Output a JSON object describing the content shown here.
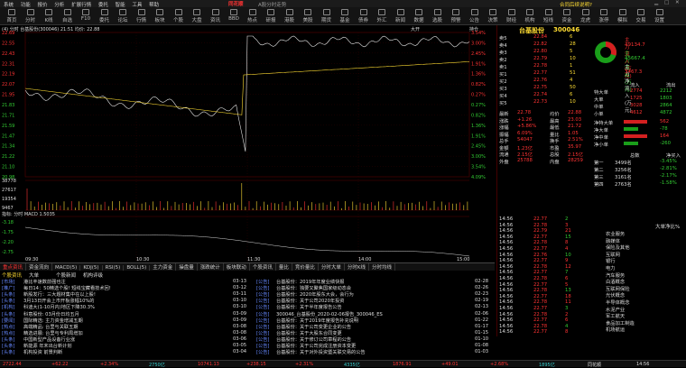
{
  "titlebar": {
    "menus": [
      "系统",
      "功能",
      "报价",
      "分析",
      "扩展行情",
      "委托",
      "智能",
      "工具",
      "帮助"
    ],
    "brand": "同花顺",
    "subtitle": "A股分时走势",
    "right_text": "合同后续说明?"
  },
  "toolbar": {
    "buttons": [
      "首页",
      "分时",
      "K线",
      "自选",
      "F10",
      "委托",
      "论坛",
      "行情",
      "板块",
      "个股",
      "大盘",
      "资讯",
      "BBD",
      "热点",
      "研报",
      "港股",
      "美股",
      "期货",
      "基金",
      "债券",
      "外汇",
      "新闻",
      "数据",
      "选股",
      "预警",
      "公告",
      "决策",
      "财经",
      "机构",
      "短线",
      "资金",
      "龙虎",
      "涨停",
      "模拟",
      "交易",
      "设置"
    ]
  },
  "chart": {
    "header": "(4) 分时 台基股份(300046) 21:51 均价: 22.88",
    "right_label": "大开",
    "right_label2": "持仓",
    "price_left": [
      "22.69",
      "22.55",
      "22.43",
      "22.31",
      "22.19",
      "22.07",
      "21.95",
      "21.83",
      "21.71",
      "21.59",
      "21.47",
      "21.34",
      "21.22",
      "21.10",
      "20.98"
    ],
    "pct_right": [
      "3.54%",
      "3.00%",
      "2.45%",
      "1.91%",
      "1.36%",
      "0.82%",
      "0.27%",
      "0.27%",
      "0.82%",
      "1.36%",
      "1.91%",
      "2.45%",
      "3.00%",
      "3.54%",
      "4.09%"
    ],
    "vol_left": [
      "38778",
      "27617",
      "19354",
      "9467"
    ],
    "macd_label": "指标: 分时 MACD  1.5035  ",
    "macd_left": [
      "-3.18",
      "-1.75",
      "-2.20",
      "-2.75"
    ],
    "time_labels": [
      "09:30",
      "10:30",
      "11:30",
      "14:00",
      "15:00"
    ]
  },
  "tabs": [
    "重点资讯",
    "资金流向",
    "MACD(5)",
    "KDJ(5)",
    "RSI(5)",
    "BOLL(5)",
    "主力资金",
    "操盘量",
    "涨跌统计",
    "板块联动",
    "个股资讯",
    "量比",
    "竞价量比",
    "分时大单",
    "分时K线",
    "分时均线"
  ],
  "news_tabs": [
    "个股资讯",
    "大单",
    "个股新闻",
    "机构评级"
  ],
  "news": [
    {
      "tag": "[市场]",
      "title": "港比丰速数前强也注",
      "date": "03-13",
      "src": "[公告]",
      "title2": "台基股份：2019年年度业绩快报",
      "date2": "02-28"
    },
    {
      "tag": "[推广]",
      "title": "每日14：50精选个股! 短线宝藏看技术回!",
      "date": "03-12",
      "src": "[公告]",
      "title2": "台基股份：独要又聚焦国家级动态会",
      "date2": "02-26"
    },
    {
      "tag": "[头条]",
      "title": "新股发行：三大题材集中在以上股!",
      "date": "03-11",
      "src": "[公告]",
      "title2": "台基股份：2020年股东大会，会行为",
      "date2": "02-23"
    },
    {
      "tag": "[头条]",
      "title": "3月13日开会上市开板涨幅10%的",
      "date": "03-10",
      "src": "[公告]",
      "title2": "台基股份：关于公司2020年投资",
      "date2": "02-19"
    },
    {
      "tag": "[机构]",
      "title": "科迪大(1-10月内)地区下降30.3%",
      "date": "03-10",
      "src": "[公告]",
      "title2": "台基股份：关于半年度报告公告",
      "date2": "02-13"
    },
    {
      "tag": "[头条]",
      "title": "科意股份: 03月份日均五月",
      "date": "03-09",
      "src": "[公告]",
      "title2": "300046_台基股份_2020-02-06报告_300046_ES",
      "date2": "02-06"
    },
    {
      "tag": "[要闻]",
      "title": "国际精选: 主力资金增减五期",
      "date": "03-09",
      "src": "[公告]",
      "title2": "台基股份：关于2019年度报告补充说明",
      "date2": "01-22"
    },
    {
      "tag": "[热点]",
      "title": "高端精品: 台里与关联五期",
      "date": "03-08",
      "src": "[公告]",
      "title2": "台基股份：关于公司变更企业的公告",
      "date2": "01-17"
    },
    {
      "tag": "[热点]",
      "title": "精选进展: 台里与专利局增加",
      "date": "03-08",
      "src": "[公告]",
      "title2": "台基股份：关于大股东合同变更",
      "date2": "01-15"
    },
    {
      "tag": "[头条]",
      "title": "中国新型产品设备行业涨",
      "date": "03-06",
      "src": "[公告]",
      "title2": "台基股份：关于修订公司章程的公告",
      "date2": "01-10"
    },
    {
      "tag": "[头条]",
      "title": "新能源 年末出台新计划",
      "date": "03-05",
      "src": "[公告]",
      "title2": "台基股份：关于公司完成注册资本变更",
      "date2": "01-08"
    },
    {
      "tag": "[头条]",
      "title": "机构投资 前景判断",
      "date": "03-04",
      "src": "[公告]",
      "title2": "台基股份：关于对外投资暨关联交易的公告",
      "date2": "01-03"
    },
    {
      "tag": "[头条]",
      "title": "风控建设 市场价格",
      "date": "03-03",
      "src": "[公告]",
      "title2": "台基股份：关于使用闲置资金",
      "date2": "12-30"
    }
  ],
  "right_panel": {
    "stock_name": "台基股份",
    "stock_code": "300046",
    "order_book": [
      {
        "label": "卖5",
        "price": "22.84",
        "vol": "6"
      },
      {
        "label": "卖4",
        "price": "22.82",
        "vol": "28"
      },
      {
        "label": "卖3",
        "price": "22.80",
        "vol": "5"
      },
      {
        "label": "卖2",
        "price": "22.79",
        "vol": "10"
      },
      {
        "label": "卖1",
        "price": "22.78",
        "vol": "1"
      },
      {
        "label": "买1",
        "price": "22.77",
        "vol": "51"
      },
      {
        "label": "买2",
        "price": "22.76",
        "vol": "4"
      },
      {
        "label": "买3",
        "price": "22.75",
        "vol": "50"
      },
      {
        "label": "买4",
        "price": "22.74",
        "vol": "6"
      },
      {
        "label": "买5",
        "price": "22.73",
        "vol": "10"
      }
    ],
    "stats": [
      {
        "k": "最新",
        "v": "22.78",
        "k2": "均价",
        "v2": "22.88"
      },
      {
        "k": "涨跌",
        "v": "+1.26",
        "k2": "最高",
        "v2": "23.03"
      },
      {
        "k": "涨幅",
        "v": "+5.86%",
        "k2": "最低",
        "v2": "21.72"
      },
      {
        "k": "振幅",
        "v": "6.09%",
        "k2": "量比",
        "v2": "1.05"
      },
      {
        "k": "总手",
        "v": "54047",
        "k2": "换手",
        "v2": "2.51%"
      },
      {
        "k": "金额",
        "v": "1.23亿",
        "k2": "市盈",
        "v2": "35.97"
      },
      {
        "k": "流通",
        "v": "2.15亿",
        "k2": "总股",
        "v2": "2.15亿"
      },
      {
        "k": "外盘",
        "v": "25788",
        "k2": "内盘",
        "v2": "28259"
      }
    ],
    "fund_flow": {
      "title1": "主力流入(万元)",
      "title2": "主力流出(万元)",
      "title3": "主力净流入(万元)",
      "in_val": "49134.7",
      "out_val": "45667.4",
      "net_val": "3467.3"
    },
    "flow_table": {
      "header": [
        "",
        "流入",
        "流出"
      ],
      "rows": [
        {
          "k": "特大单",
          "in": "2774",
          "out": "2212"
        },
        {
          "k": "大单",
          "in": "1725",
          "out": "1803"
        },
        {
          "k": "中单",
          "in": "3028",
          "out": "2864"
        },
        {
          "k": "小单",
          "in": "4612",
          "out": "4872"
        }
      ]
    },
    "net_table": {
      "header": [
        "",
        "总数",
        "净买入"
      ],
      "rows": [
        {
          "k": "净特大单",
          "v": "562",
          "v2": "-"
        },
        {
          "k": "净大单",
          "v": "-78",
          "v2": "-"
        },
        {
          "k": "净中单",
          "v": "164",
          "v2": "-"
        },
        {
          "k": "净小单",
          "v": "-260",
          "v2": "-"
        }
      ]
    },
    "ranks": [
      {
        "k": "第一",
        "v": "3499名",
        "p": "-3.45%"
      },
      {
        "k": "第二",
        "v": "3256名",
        "p": "-2.81%"
      },
      {
        "k": "第三",
        "v": "3161名",
        "p": "-2.17%"
      },
      {
        "k": "第四",
        "v": "2763名",
        "p": "-1.58%"
      }
    ],
    "trades_header": [
      "14:56",
      "成交",
      "",
      "板块"
    ],
    "trades": [
      {
        "t": "14:56",
        "p": "22.77",
        "v": "2"
      },
      {
        "t": "14:56",
        "p": "22.78",
        "v": "3"
      },
      {
        "t": "14:56",
        "p": "22.79",
        "v": "21"
      },
      {
        "t": "14:56",
        "p": "22.77",
        "v": "15"
      },
      {
        "t": "14:56",
        "p": "22.78",
        "v": "8"
      },
      {
        "t": "14:56",
        "p": "22.77",
        "v": "4"
      },
      {
        "t": "14:56",
        "p": "22.76",
        "v": "10"
      },
      {
        "t": "14:56",
        "p": "22.77",
        "v": "9"
      },
      {
        "t": "14:56",
        "p": "22.78",
        "v": "12"
      },
      {
        "t": "14:56",
        "p": "22.77",
        "v": "7"
      },
      {
        "t": "14:56",
        "p": "22.78",
        "v": "6"
      },
      {
        "t": "14:56",
        "p": "22.77",
        "v": "5"
      },
      {
        "t": "14:56",
        "p": "22.78",
        "v": "13"
      },
      {
        "t": "14:56",
        "p": "22.77",
        "v": "18"
      },
      {
        "t": "14:56",
        "p": "22.78",
        "v": "11"
      },
      {
        "t": "14:56",
        "p": "22.77",
        "v": "3"
      },
      {
        "t": "14:56",
        "p": "22.78",
        "v": "2"
      },
      {
        "t": "14:56",
        "p": "22.77",
        "v": "6"
      },
      {
        "t": "14:56",
        "p": "22.78",
        "v": "4"
      },
      {
        "t": "14:56",
        "p": "22.77",
        "v": "8"
      }
    ],
    "sectors_title": "大单净比%",
    "sectors": [
      "农业服务",
      "融媒体",
      "保险及其他",
      "互联网",
      "银行",
      "电力",
      "汽车服务",
      "白酒概念",
      "互联网保险",
      "光伏概念",
      "半导体概念",
      "水泥产业",
      "军工航天",
      "食品加工制造",
      "机场航运"
    ]
  },
  "statusbar": [
    {
      "v": "2722.44",
      "c": "red"
    },
    {
      "v": "+62.22",
      "c": "red"
    },
    {
      "v": "+2.34%",
      "c": "red"
    },
    {
      "v": "2750亿",
      "c": "cyan"
    },
    {
      "v": "10741.13",
      "c": "red"
    },
    {
      "v": "+238.15",
      "c": "red"
    },
    {
      "v": "+2.31%",
      "c": "red"
    },
    {
      "v": "4335亿",
      "c": "cyan"
    },
    {
      "v": "1876.91",
      "c": "red"
    },
    {
      "v": "+49.01",
      "c": "red"
    },
    {
      "v": "+2.68%",
      "c": "red"
    },
    {
      "v": "1895亿",
      "c": "cyan"
    },
    {
      "v": "同花顺",
      "c": "white"
    },
    {
      "v": "14:56",
      "c": "white"
    }
  ]
}
